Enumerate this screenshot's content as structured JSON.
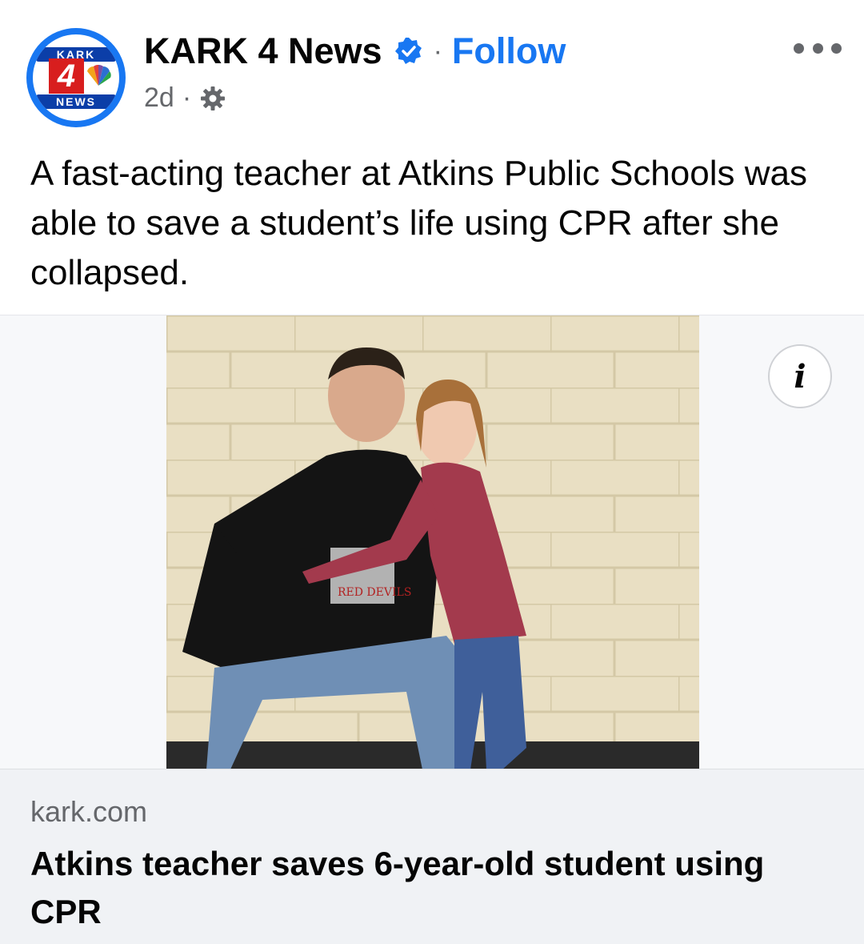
{
  "post": {
    "page_name": "KARK 4 News",
    "follow_label": "Follow",
    "timestamp": "2d",
    "separator": "·",
    "audience_icon": "gear-icon",
    "verified_icon": "verified-badge-icon",
    "more_icon": "more-options-icon",
    "caption": "A fast-acting teacher at Atkins Public Schools was able to save a student’s life using CPR after she collapsed."
  },
  "avatar_logo": {
    "top_text": "KARK",
    "number": "4",
    "bottom_text": "NEWS"
  },
  "media": {
    "info_icon": "info-icon",
    "info_label": "i",
    "shirt_text": "RED DEVILS"
  },
  "link": {
    "domain": "kark.com",
    "headline": "Atkins teacher saves 6-year-old student using CPR"
  },
  "colors": {
    "accent": "#1877f2",
    "secondary_text": "#65676b",
    "link_card_bg": "#f0f2f5"
  }
}
